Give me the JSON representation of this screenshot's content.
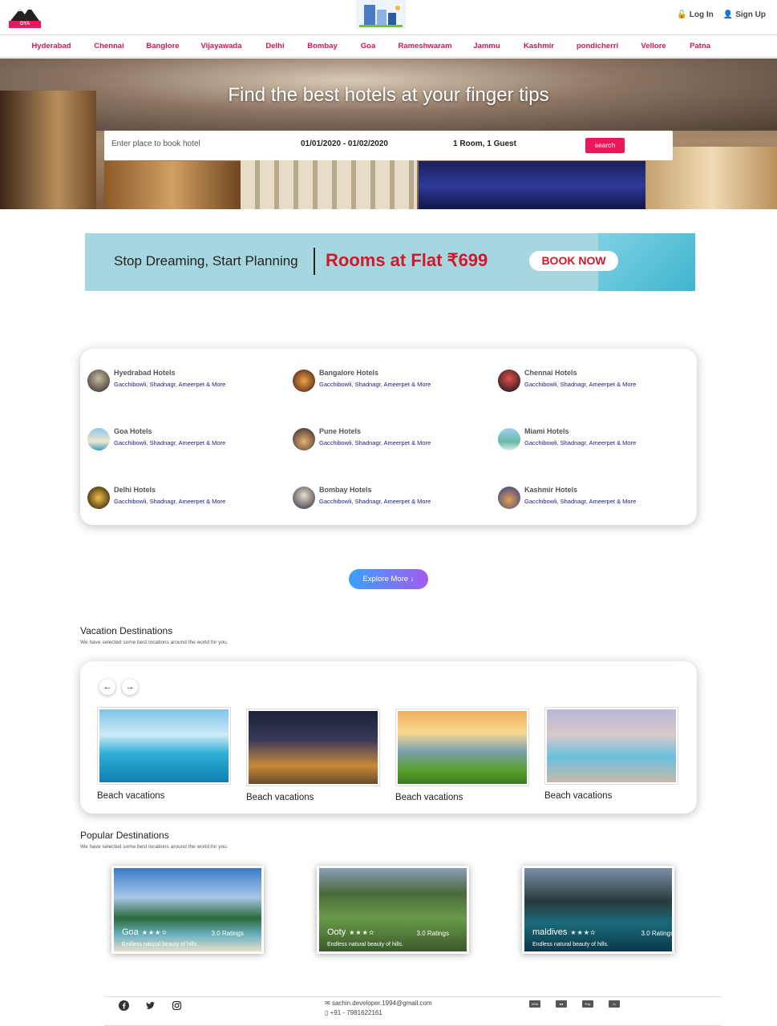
{
  "header": {
    "logo_text": "OYA",
    "login_label": "Log In",
    "signup_label": "Sign Up"
  },
  "cities": [
    "Hyderabad",
    "Chennai",
    "Banglore",
    "Vijayawada",
    "Delhi",
    "Bombay",
    "Goa",
    "Rameshwaram",
    "Jammu",
    "Kashmir",
    "pondicherri",
    "Vellore",
    "Patna"
  ],
  "hero": {
    "title": "Find the best hotels at your finger tips",
    "search_placeholder": "Enter place to book hotel",
    "dates": "01/01/2020 - 01/02/2020",
    "rooms": "1 Room, 1 Guest",
    "search_button": "search"
  },
  "promo": {
    "tagline": "Stop Dreaming, Start Planning",
    "offer": "Rooms at Flat ₹699",
    "cta": "BOOK NOW"
  },
  "hotels": [
    {
      "name": "Hyedrabad Hotels",
      "areas": "Gacchibowli, Shadnagr, Ameerpet & More"
    },
    {
      "name": "Bangalore Hotels",
      "areas": "Gacchibowli, Shadnagr, Ameerpet & More"
    },
    {
      "name": "Chennai Hotels",
      "areas": "Gacchibowli, Shadnagr, Ameerpet & More"
    },
    {
      "name": "Goa Hotels",
      "areas": "Gacchibowli, Shadnagr, Ameerpet & More"
    },
    {
      "name": "Pune Hotels",
      "areas": "Gacchibowli, Shadnagr, Ameerpet & More"
    },
    {
      "name": "Miami Hotels",
      "areas": "Gacchibowli, Shadnagr, Ameerpet & More"
    },
    {
      "name": "Delhi Hotels",
      "areas": "Gacchibowli, Shadnagr, Ameerpet & More"
    },
    {
      "name": "Bombay Hotels",
      "areas": "Gacchibowli, Shadnagr, Ameerpet & More"
    },
    {
      "name": "Kashmir Hotels",
      "areas": "Gacchibowli, Shadnagr, Ameerpet & More"
    }
  ],
  "explore_label": "Explore More",
  "vacation": {
    "title": "Vacation Destinations",
    "subtitle": "We have selected some best locations around the world for you.",
    "items": [
      "Beach vacations",
      "Beach vacations",
      "Beach vacations",
      "Beach vacations"
    ]
  },
  "popular": {
    "title": "Popular Destinations",
    "subtitle": "We have selected some best locations around the world for you.",
    "items": [
      {
        "name": "Goa",
        "rating": "3.0 Ratings",
        "stars": 3.5,
        "desc": "Endless natural beauty of hills."
      },
      {
        "name": "Ooty",
        "rating": "3.0 Ratings",
        "stars": 3.5,
        "desc": "Endless natural beauty of hills."
      },
      {
        "name": "maldives",
        "rating": "3.0 Ratings",
        "stars": 3.5,
        "desc": "Endless natural beauty of hills."
      }
    ]
  },
  "footer": {
    "email": "sachin.developer.1994@gmail.com",
    "phone": "+91 - 7981622161",
    "social_icons": [
      "facebook-icon",
      "twitter-icon",
      "instagram-icon"
    ],
    "payment_icons": [
      "visa-icon",
      "mastercard-icon",
      "paypal-icon",
      "card-icon"
    ]
  },
  "colors": {
    "accent": "#e8185a",
    "city_link": "#d4145a",
    "hotel_sub": "#1a1a7a"
  }
}
